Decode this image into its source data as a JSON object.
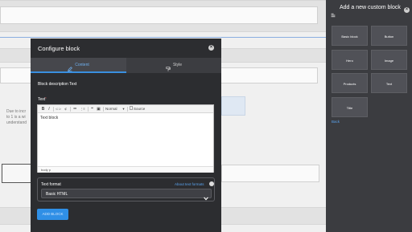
{
  "background": {
    "snippet_lines": [
      "Due to incr",
      "to 1 is a wi",
      "understand"
    ]
  },
  "modal": {
    "title": "Configure block",
    "close_glyph": "×",
    "tabs": [
      {
        "label": "Content",
        "icon": "pencil-icon",
        "active": true
      },
      {
        "label": "Style",
        "icon": "paint-roller-icon",
        "active": false
      }
    ],
    "block_description_label": "Block description Text",
    "text_label": "Text",
    "required_mark": "*",
    "editor": {
      "toolbar": {
        "bold": "B",
        "italic": "I",
        "link": "⊂⊃",
        "unlink": "⊄",
        "bulleted_list": "≔",
        "numbered_list": "⋮≡",
        "blockquote": "❝",
        "image": "▣",
        "format_value": "Normal",
        "format_arrow": "▾",
        "source": "Source"
      },
      "content": "Text block",
      "status_path": "body  p"
    },
    "text_format": {
      "label": "Text format",
      "about_link": "About text formats",
      "selected": "Basic HTML"
    },
    "add_button": "ADD BLOCK"
  },
  "sidebar": {
    "title": "Add a new custom block",
    "close_glyph": "×",
    "blocks": [
      "Basic block",
      "Button",
      "Hero",
      "Image",
      "Products",
      "Text",
      "Title"
    ],
    "back_link": "Back"
  },
  "colors": {
    "accent": "#2f8fe6",
    "link": "#5aa3ee",
    "modal_bg": "#2c2d30",
    "sidebar_bg": "#3b3c40"
  }
}
